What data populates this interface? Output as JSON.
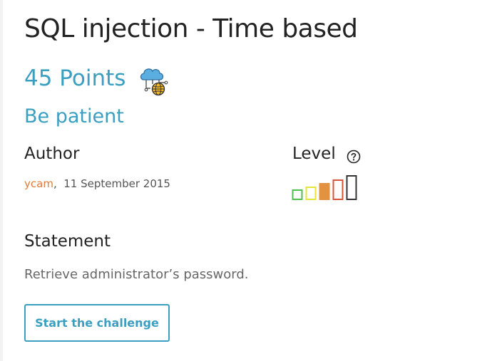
{
  "challenge": {
    "title": "SQL injection - Time based",
    "points": "45 Points",
    "subtitle": "Be patient",
    "category_icon": "cloud-network-globe-icon"
  },
  "author": {
    "heading": "Author",
    "name": "ycam",
    "separator": ",",
    "date": "11 September 2015"
  },
  "level": {
    "heading": "Level",
    "help_icon": "question-circle-icon",
    "value": 3,
    "max": 5,
    "colors": [
      "#4cc14c",
      "#e6e63a",
      "#e3923f",
      "#d9533b",
      "#333333"
    ]
  },
  "statement": {
    "heading": "Statement",
    "text": "Retrieve administrator’s password."
  },
  "actions": {
    "start_label": "Start the challenge"
  },
  "colors": {
    "accent": "#3a9fc1",
    "author_link": "#e07b39"
  }
}
